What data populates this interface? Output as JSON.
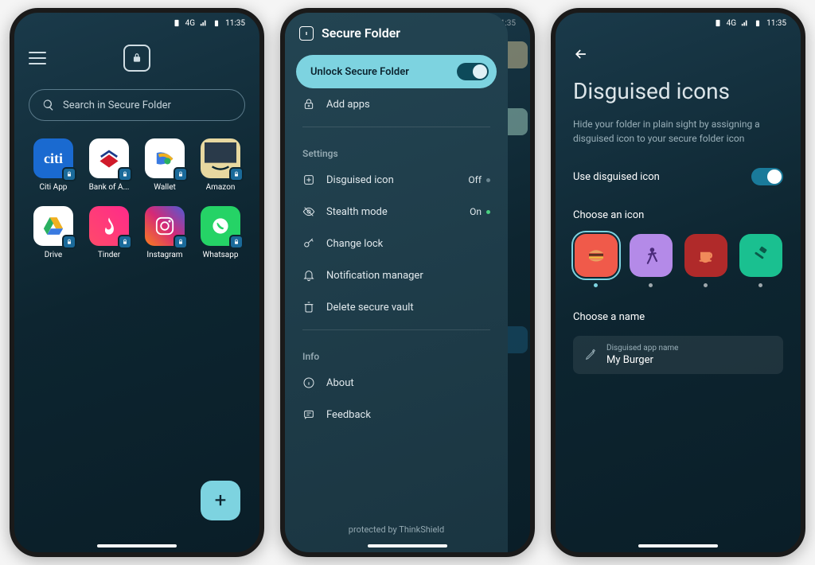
{
  "status": {
    "time": "11:35",
    "net": "4G"
  },
  "screen1": {
    "search_placeholder": "Search in Secure Folder",
    "apps": [
      {
        "name": "Citi App",
        "key": "citi"
      },
      {
        "name": "Bank of A...",
        "key": "boa"
      },
      {
        "name": "Wallet",
        "key": "wallet"
      },
      {
        "name": "Amazon",
        "key": "amazon"
      },
      {
        "name": "Drive",
        "key": "drive"
      },
      {
        "name": "Tinder",
        "key": "tinder"
      },
      {
        "name": "Instagram",
        "key": "insta"
      },
      {
        "name": "Whatsapp",
        "key": "wa"
      }
    ]
  },
  "screen2": {
    "title": "Secure Folder",
    "unlock_label": "Unlock Secure Folder",
    "add_apps": "Add apps",
    "section_settings": "Settings",
    "items": {
      "disguised": {
        "label": "Disguised icon",
        "value": "Off",
        "state": "off"
      },
      "stealth": {
        "label": "Stealth mode",
        "value": "On",
        "state": "on"
      },
      "change": {
        "label": "Change lock"
      },
      "notif": {
        "label": "Notification manager"
      },
      "delete": {
        "label": "Delete secure vault"
      }
    },
    "section_info": "Info",
    "about": "About",
    "feedback": "Feedback",
    "footer": "protected by ThinkShield"
  },
  "screen3": {
    "title": "Disguised icons",
    "description": "Hide your folder in plain sight by assigning a disguised icon to your secure folder icon",
    "toggle_label": "Use disguised icon",
    "choose_icon": "Choose an icon",
    "choose_name": "Choose a name",
    "name_label": "Disguised app name",
    "name_value": "My Burger",
    "icons": [
      {
        "key": "burger",
        "color": "#f05a4a",
        "selected": true
      },
      {
        "key": "dance",
        "color": "#b48ae8",
        "selected": false
      },
      {
        "key": "coffee",
        "color": "#b02a2a",
        "selected": false
      },
      {
        "key": "hammer",
        "color": "#1ac090",
        "selected": false
      }
    ]
  }
}
